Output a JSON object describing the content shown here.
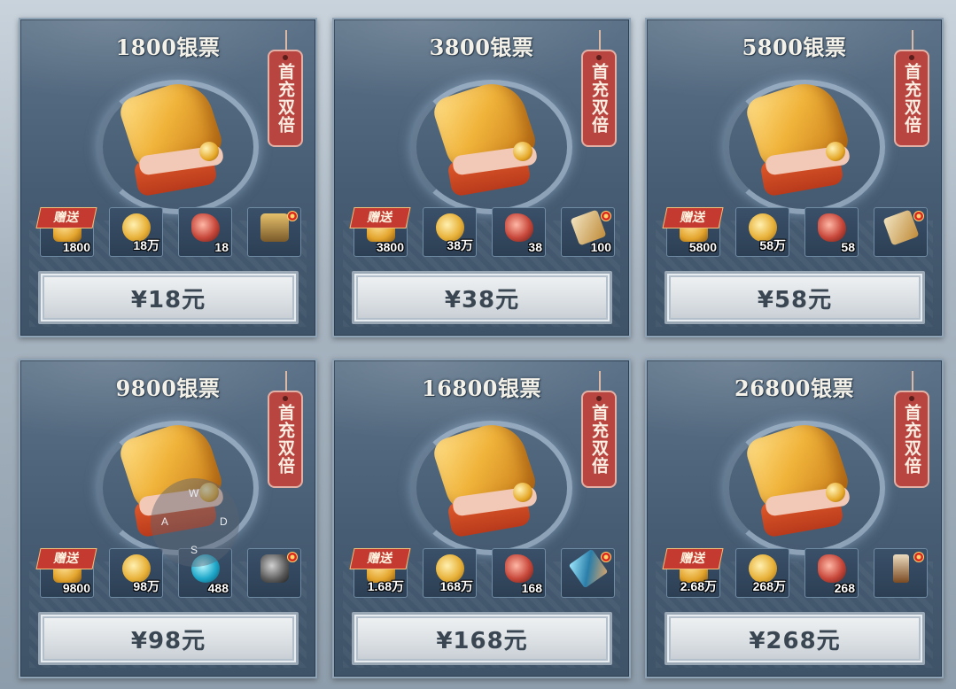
{
  "cards": [
    {
      "title": "1800银票",
      "tag": "首充双倍",
      "gift_label": "赠送",
      "items": [
        {
          "icon": "silver-note-icon",
          "qty": "1800"
        },
        {
          "icon": "copper-coin-icon",
          "qty": "18万"
        },
        {
          "icon": "red-gem-icon",
          "qty": "18"
        },
        {
          "icon": "treasure-chest-icon",
          "qty": ""
        }
      ],
      "price": "¥18元"
    },
    {
      "title": "3800银票",
      "tag": "首充双倍",
      "gift_label": "赠送",
      "items": [
        {
          "icon": "silver-note-icon",
          "qty": "3800"
        },
        {
          "icon": "copper-coin-icon",
          "qty": "38万"
        },
        {
          "icon": "red-gem-icon",
          "qty": "38"
        },
        {
          "icon": "scroll-icon",
          "qty": "100"
        }
      ],
      "price": "¥38元"
    },
    {
      "title": "5800银票",
      "tag": "首充双倍",
      "gift_label": "赠送",
      "items": [
        {
          "icon": "silver-note-icon",
          "qty": "5800"
        },
        {
          "icon": "copper-coin-icon",
          "qty": "58万"
        },
        {
          "icon": "red-gem-icon",
          "qty": "58"
        },
        {
          "icon": "map-scroll-icon",
          "qty": ""
        }
      ],
      "price": "¥58元"
    },
    {
      "title": "9800银票",
      "tag": "首充双倍",
      "gift_label": "赠送",
      "items": [
        {
          "icon": "silver-note-icon",
          "qty": "9800"
        },
        {
          "icon": "copper-coin-icon",
          "qty": "98万"
        },
        {
          "icon": "blue-orb-icon",
          "qty": "488"
        },
        {
          "icon": "token-icon",
          "qty": ""
        }
      ],
      "price": "¥98元"
    },
    {
      "title": "16800银票",
      "tag": "首充双倍",
      "gift_label": "赠送",
      "items": [
        {
          "icon": "silver-note-icon",
          "qty": "1.68万"
        },
        {
          "icon": "copper-coin-icon",
          "qty": "168万"
        },
        {
          "icon": "red-gem-icon",
          "qty": "168"
        },
        {
          "icon": "blade-icon",
          "qty": ""
        }
      ],
      "price": "¥168元"
    },
    {
      "title": "26800银票",
      "tag": "首充双倍",
      "gift_label": "赠送",
      "items": [
        {
          "icon": "silver-note-icon",
          "qty": "2.68万"
        },
        {
          "icon": "copper-coin-icon",
          "qty": "268万"
        },
        {
          "icon": "red-gem-icon",
          "qty": "268"
        },
        {
          "icon": "brush-icon",
          "qty": ""
        }
      ],
      "price": "¥268元"
    }
  ],
  "joystick": {
    "up": "W",
    "left": "A",
    "right": "D",
    "down": "S"
  },
  "colors": {
    "card_bg": "#4f667c",
    "tag_red": "#b8453f",
    "price_text": "#3a4753",
    "title_text": "#f4f1e8"
  }
}
